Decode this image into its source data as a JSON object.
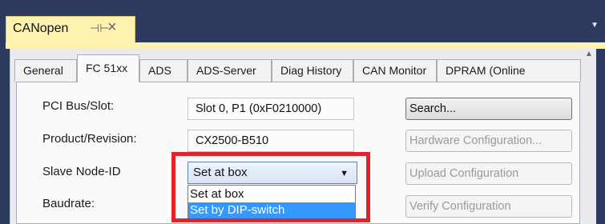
{
  "document_tab": {
    "title": "CANopen",
    "pin_icon": "pin-icon",
    "close_icon": "close-icon"
  },
  "tabs": [
    {
      "label": "General",
      "active": false
    },
    {
      "label": "FC 51xx",
      "active": true
    },
    {
      "label": "ADS",
      "active": false
    },
    {
      "label": "ADS-Server",
      "active": false
    },
    {
      "label": "Diag History",
      "active": false
    },
    {
      "label": "CAN Monitor",
      "active": false
    },
    {
      "label": "DPRAM (Online",
      "active": false
    }
  ],
  "form": {
    "pci_bus_slot": {
      "label": "PCI Bus/Slot:",
      "value": "Slot 0, P1 (0xF0210000)"
    },
    "product_revision": {
      "label": "Product/Revision:",
      "value": "CX2500-B510"
    },
    "slave_node_id": {
      "label": "Slave Node-ID",
      "value": "Set at box",
      "options": [
        "Set at box",
        "Set by DIP-switch"
      ],
      "highlighted_option": "Set by DIP-switch"
    },
    "baudrate": {
      "label": "Baudrate:"
    }
  },
  "buttons": {
    "search": {
      "label": "Search...",
      "enabled": true
    },
    "hardware_configuration": {
      "label": "Hardware Configuration...",
      "enabled": false
    },
    "upload_configuration": {
      "label": "Upload Configuration",
      "enabled": false
    },
    "verify_configuration": {
      "label": "Verify Configuration",
      "enabled": false
    }
  },
  "colors": {
    "document_tab": "#fff2b0",
    "frame": "#2b3a5e",
    "highlight_box": "#e2232a",
    "selected_option": "#3399ff"
  }
}
